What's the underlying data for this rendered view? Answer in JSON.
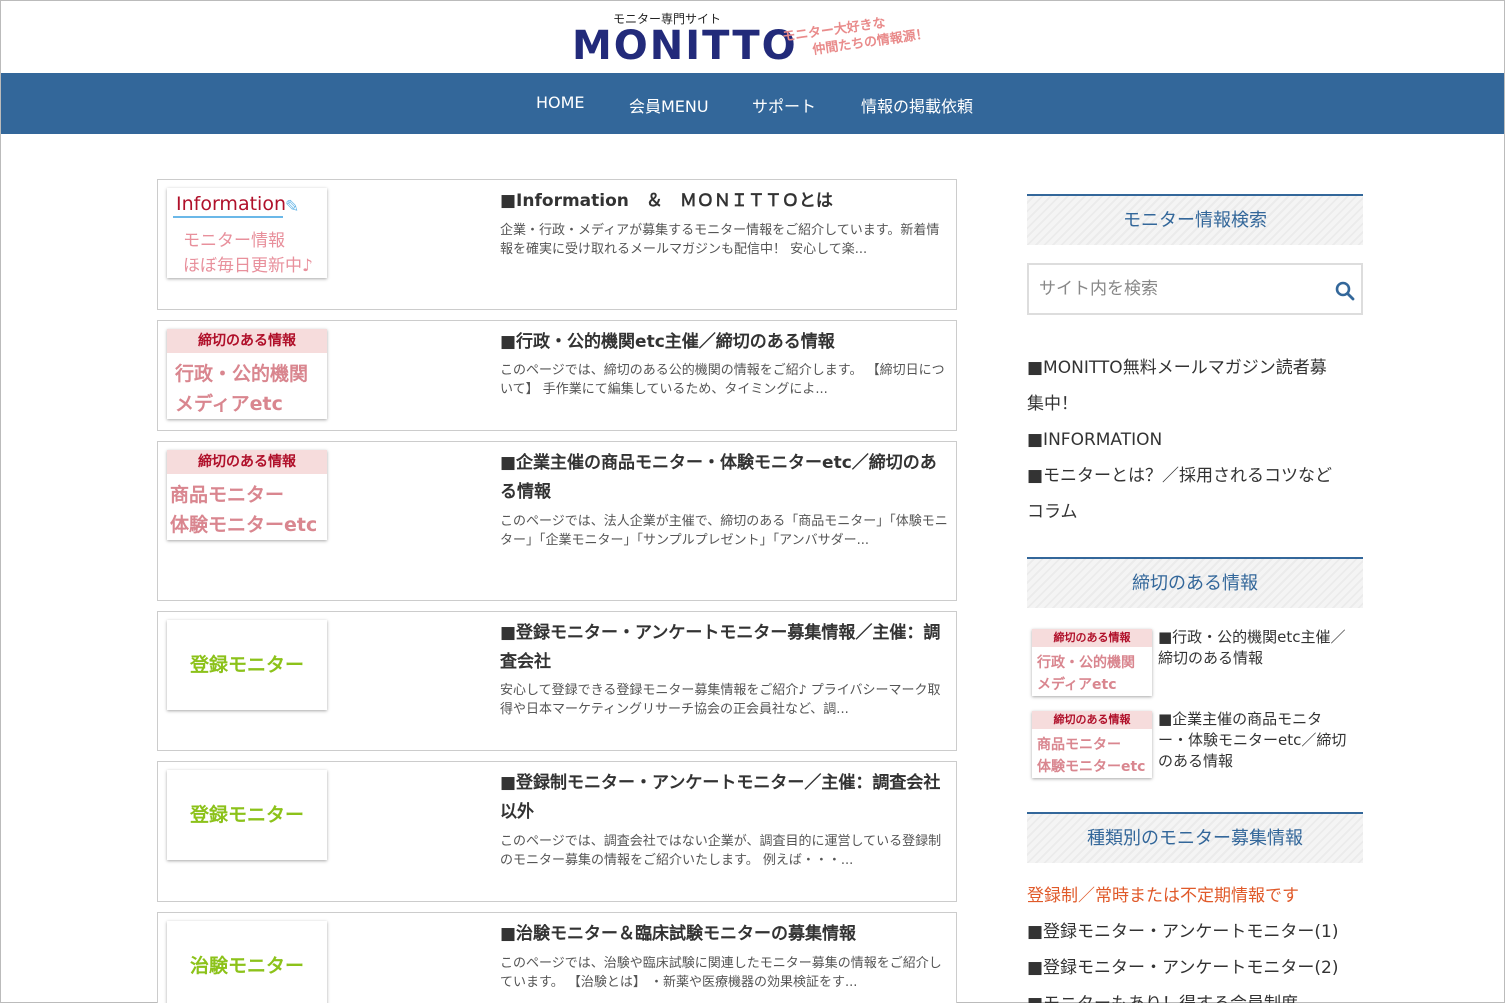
{
  "header": {
    "logo_sub": "モニター専門サイト",
    "logo_main": "MONITTO",
    "tagline_1": "モニター大好きな",
    "tagline_2": "仲間たちの情報源！"
  },
  "nav": {
    "items": [
      "HOME",
      "会員MENU",
      "サポート",
      "情報の掲載依頼"
    ]
  },
  "cards": [
    {
      "title": "■Information　＆　ＭＯＮＩＴＴＯとは",
      "excerpt": "企業・行政・メディアが募集するモニター情報をご紹介しています。新着情報を確実に受け取れるメールマガジンも配信中！ 安心して楽...",
      "thumb": {
        "label": "Information",
        "line1": "モニター情報",
        "line2": "ほぼ毎日更新中♪"
      }
    },
    {
      "title": "■行政・公的機関etc主催／締切のある情報",
      "excerpt": "このページでは、締切のある公的機関の情報をご紹介します。 【締切日について】 手作業にて編集しているため、タイミングによ...",
      "thumb": {
        "band": "締切のある情報",
        "line1": "行政・公的機関",
        "line2": "メディアetc"
      }
    },
    {
      "title": "■企業主催の商品モニター・体験モニターetc／締切のある情報",
      "excerpt": "このページでは、法人企業が主催で、締切のある「商品モニター」「体験モニター」「企業モニター」「サンプルプレゼント」「アンバサダー...",
      "thumb": {
        "band": "締切のある情報",
        "line1": "商品モニター",
        "line2": "体験モニターetc"
      }
    },
    {
      "title": "■登録モニター・アンケートモニター募集情報／主催：調査会社",
      "excerpt": "安心して登録できる登録モニター募集情報をご紹介♪ プライバシーマーク取得や日本マーケティングリサーチ協会の正会員社など、調...",
      "thumb": {
        "label": "登録モニター"
      }
    },
    {
      "title": "■登録制モニター・アンケートモニター／主催：調査会社以外",
      "excerpt": "このページでは、調査会社ではない企業が、調査目的に運営している登録制のモニター募集の情報をご紹介いたします。 例えば・・・...",
      "thumb": {
        "label": "登録モニター"
      }
    },
    {
      "title": "■治験モニター＆臨床試験モニターの募集情報",
      "excerpt": "このページでは、治験や臨床試験に関連したモニター募集の情報をご紹介しています。 【治験とは】 ・新薬や医療機器の効果検証をす...",
      "thumb": {
        "label": "治験モニター"
      }
    }
  ],
  "sidebar": {
    "search_title": "モニター情報検索",
    "search_placeholder": "サイト内を検索",
    "links": [
      "■MONITTO無料メールマガジン読者募",
      "集中！",
      "■INFORMATION",
      "■モニターとは？／採用されるコツなど",
      "コラム"
    ],
    "deadline_title": "締切のある情報",
    "deadline_items": [
      {
        "band": "締切のある情報",
        "line1": "行政・公的機関",
        "line2": "メディアetc",
        "text_1": "■行政・公的機関etc主催／",
        "text_2": "締切のある情報"
      },
      {
        "band": "締切のある情報",
        "line1": "商品モニター",
        "line2": "体験モニターetc",
        "text_1": "■企業主催の商品モニタ",
        "text_2": "ー・体験モニターetc／締切",
        "text_3": "のある情報"
      }
    ],
    "types_title": "種類別のモニター募集情報",
    "types_note": "登録制／常時または不定期情報です",
    "type_links": [
      "■登録モニター・アンケートモニター(1)",
      "■登録モニター・アンケートモニター(2)",
      "■モニターもあり！得する会員制度"
    ]
  }
}
